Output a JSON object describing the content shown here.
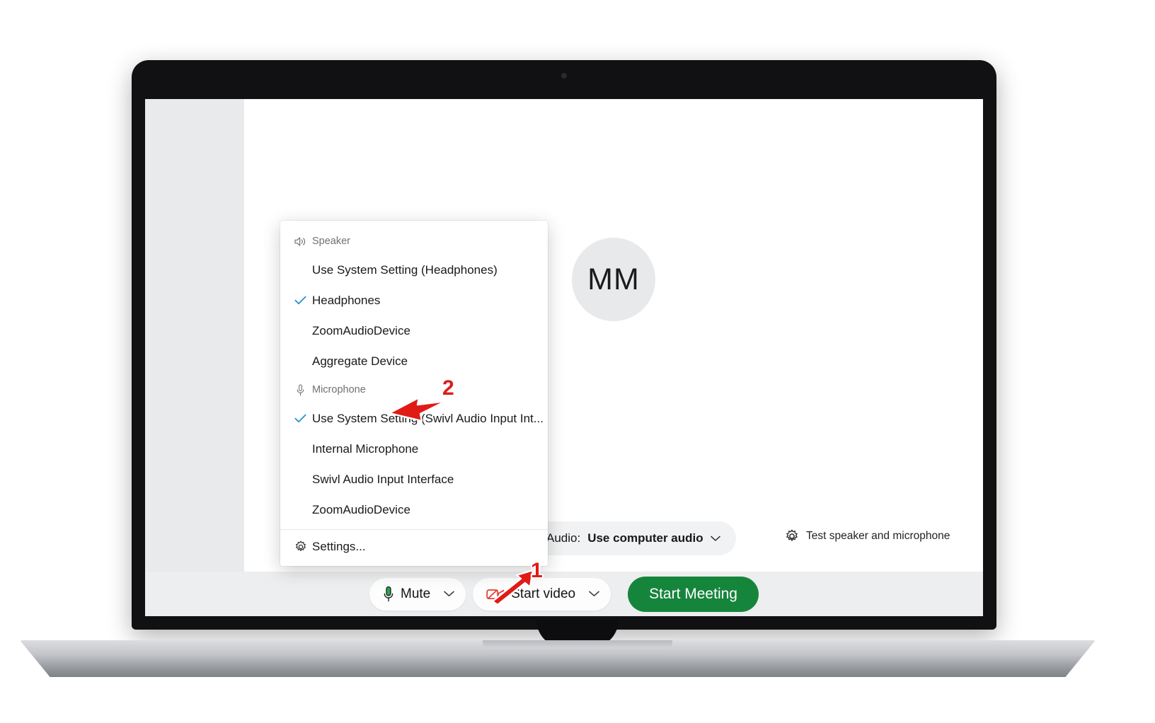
{
  "app": {
    "avatar_initials": "MM",
    "avatar_name": "avatar"
  },
  "audio_status": {
    "label": "Audio:",
    "value": "Use computer audio",
    "test_link": "Test speaker and microphone"
  },
  "toolbar": {
    "mute_label": "Mute",
    "start_video_label": "Start video",
    "start_meeting_label": "Start Meeting"
  },
  "dropdown": {
    "speaker_group": "Speaker",
    "microphone_group": "Microphone",
    "speaker_items": [
      {
        "label": "Use System Setting (Headphones)",
        "checked": false
      },
      {
        "label": "Headphones",
        "checked": true
      },
      {
        "label": "ZoomAudioDevice",
        "checked": false
      },
      {
        "label": "Aggregate Device",
        "checked": false
      }
    ],
    "microphone_items": [
      {
        "label": "Use System Setting (Swivl Audio Input Int...",
        "checked": true
      },
      {
        "label": "Internal Microphone",
        "checked": false
      },
      {
        "label": "Swivl Audio Input Interface",
        "checked": false
      },
      {
        "label": "ZoomAudioDevice",
        "checked": false
      }
    ],
    "settings_label": "Settings..."
  },
  "annotations": [
    {
      "number": "1"
    },
    {
      "number": "2"
    }
  ],
  "colors": {
    "accent_green": "#16853c",
    "check_blue": "#2b8fd0",
    "annotation_red": "#e01b16",
    "mic_green": "#2aa84a",
    "video_red": "#e23b2e",
    "badge_blue": "#2196d8"
  }
}
